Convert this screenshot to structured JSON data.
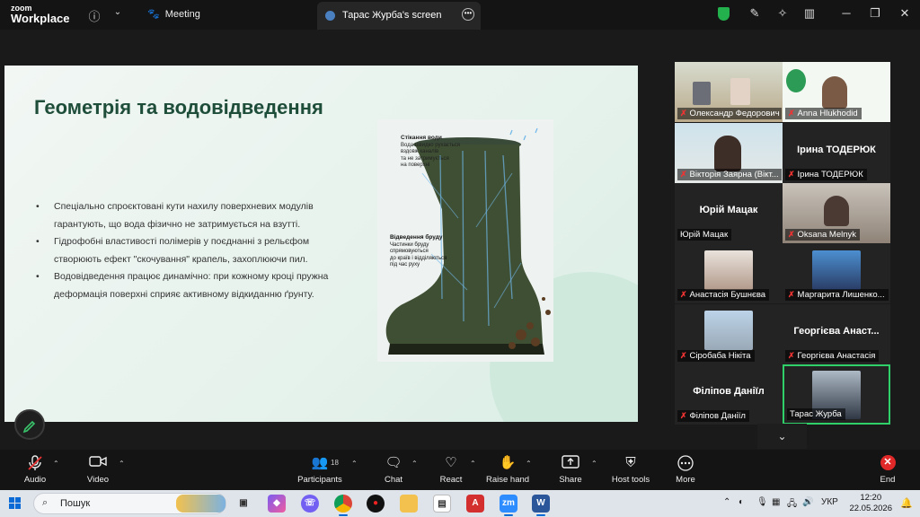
{
  "app": {
    "logo_small": "zoom",
    "logo_big": "Workplace",
    "meeting_label": "Meeting",
    "screen_tab": "Тарас Журба's screen"
  },
  "slide": {
    "title": "Геометрія та водовідведення",
    "bullets": [
      "Спеціально спроєктовані кути нахилу поверхневих модулів гарантують, що вода фізично не затримується на взутті.",
      "Гідрофобні властивості полімерів у поєднанні з рельєфом створюють ефект \"скочування\" крапель, захоплюючи пил.",
      "Водовідведення працює динамічно: при кожному кроці пружна деформація поверхні сприяє активному відкиданню ґрунту."
    ],
    "image": {
      "ann1_title": "Стікання води",
      "ann1_lines": [
        "Вода швидко рухається",
        "вздовж каналів",
        "та не затримується",
        "на поверхні"
      ],
      "ann2_title": "Відведення бруду",
      "ann2_lines": [
        "Частинки бруду",
        "спрямовуються",
        "до країв і відділяються",
        "під час руху"
      ]
    }
  },
  "participants": [
    {
      "name": "Олександр Федорович",
      "type": "video"
    },
    {
      "name": "Anna Hlukhodid",
      "type": "video"
    },
    {
      "name": "Вікторія Заярна (Вікт...",
      "type": "video"
    },
    {
      "name": "Ірина ТОДЕРЮК",
      "big": "Ірина ТОДЕРЮК",
      "type": "name"
    },
    {
      "name": "Юрій Мацак",
      "big": "Юрій Мацак",
      "type": "name"
    },
    {
      "name": "Oksana Melnyk",
      "type": "video"
    },
    {
      "name": "Анастасія Бушнєва",
      "type": "photo"
    },
    {
      "name": "Маргарита Лишенко...",
      "type": "photo"
    },
    {
      "name": "Сіробаба Нікіта",
      "type": "photo"
    },
    {
      "name": "Георгієва Анастасія",
      "big": "Георгієва Анаст...",
      "type": "name"
    },
    {
      "name": "Філіпов Даніїл",
      "big": "Філіпов Даніїл",
      "type": "name"
    },
    {
      "name": "Тарас Журба",
      "type": "photo"
    }
  ],
  "toolbar": {
    "audio": "Audio",
    "video": "Video",
    "participants": "Participants",
    "participants_count": "18",
    "chat": "Chat",
    "react": "React",
    "raise_hand": "Raise hand",
    "share": "Share",
    "host_tools": "Host tools",
    "more": "More",
    "end": "End"
  },
  "taskbar": {
    "search": "Пошук",
    "lang": "УКР",
    "time": "12:20",
    "date": "22.05.2026"
  }
}
